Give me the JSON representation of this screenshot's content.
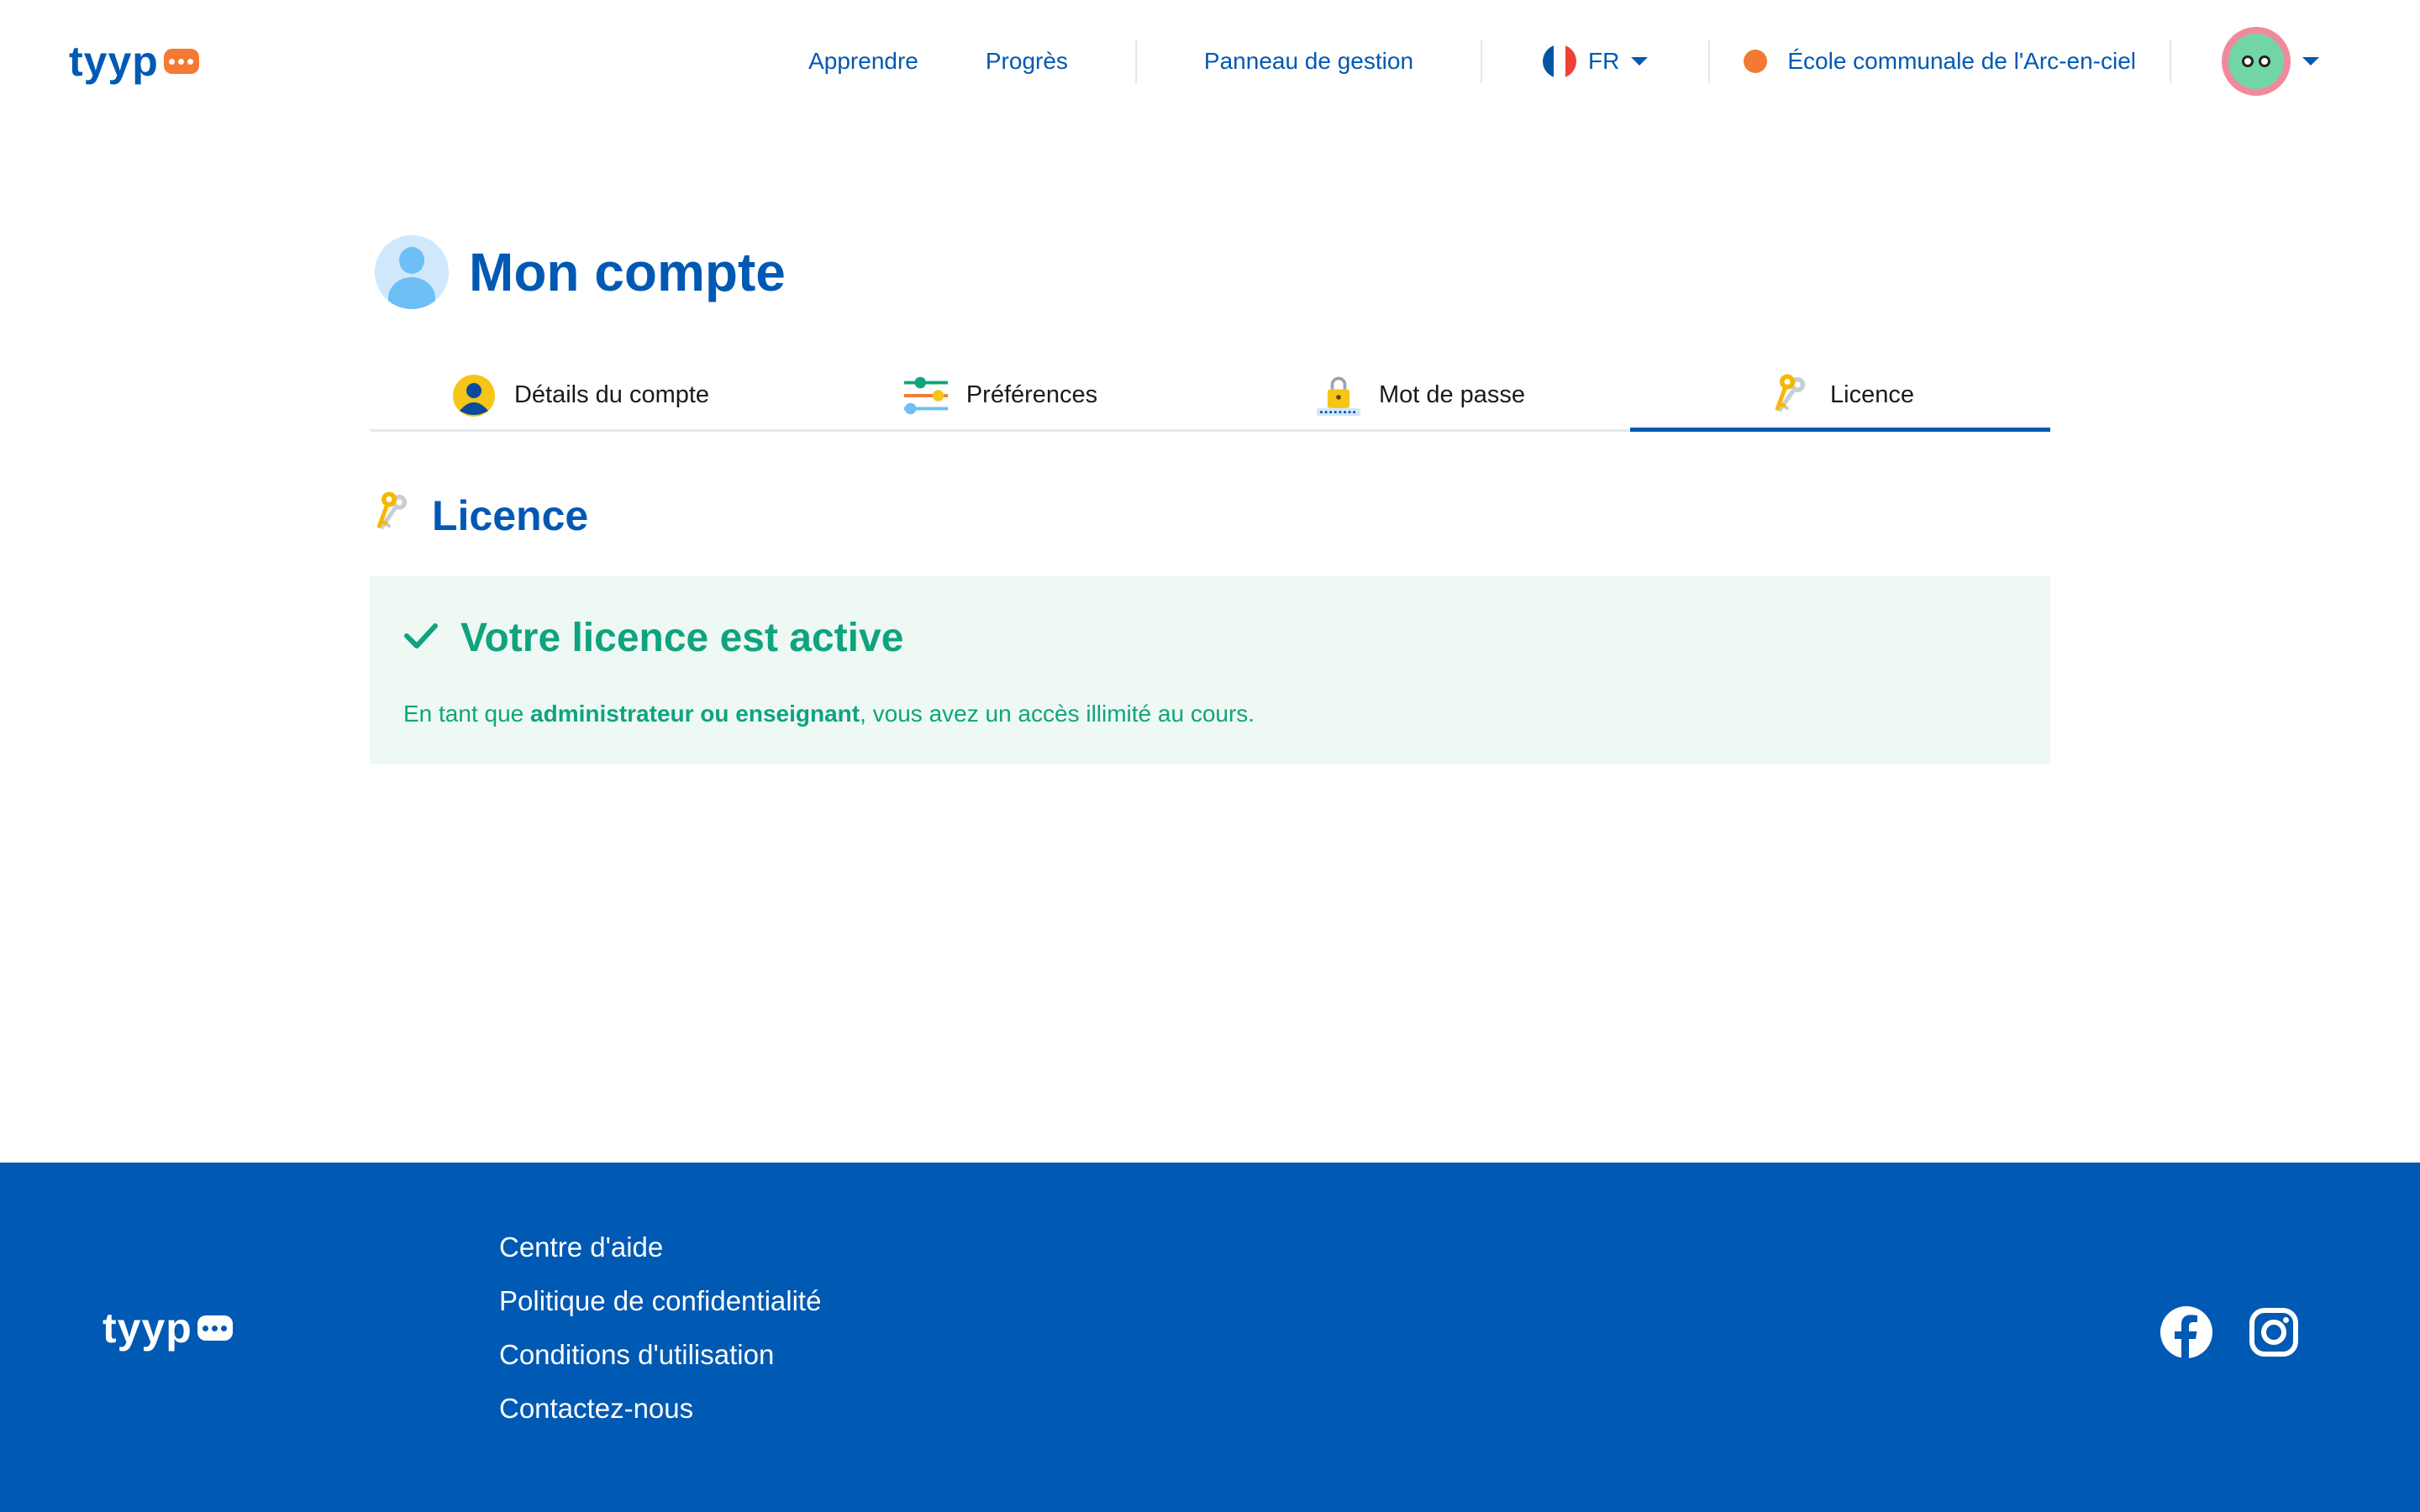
{
  "header": {
    "logo_text": "tyyp",
    "nav": {
      "learn": "Apprendre",
      "progress": "Progrès",
      "admin_panel": "Panneau de gestion"
    },
    "language": "FR",
    "school": "École communale de l'Arc-en-ciel"
  },
  "main": {
    "title": "Mon compte",
    "tabs": [
      {
        "label": "Détails du compte",
        "icon": "person-icon"
      },
      {
        "label": "Préférences",
        "icon": "sliders-icon"
      },
      {
        "label": "Mot de passe",
        "icon": "lock-icon"
      },
      {
        "label": "Licence",
        "icon": "keys-icon",
        "active": true
      }
    ],
    "section_title": "Licence",
    "license": {
      "status": "Votre licence est active",
      "desc_prefix": "En tant que ",
      "desc_bold": "administrateur ou enseignant",
      "desc_suffix": ", vous avez un accès illimité au cours."
    }
  },
  "footer": {
    "logo_text": "tyyp",
    "links": [
      "Centre d'aide",
      "Politique de confidentialité",
      "Conditions d'utilisation",
      "Contactez-nous"
    ],
    "social": [
      "facebook-icon",
      "instagram-icon"
    ]
  },
  "colors": {
    "brand_blue": "#0059b3",
    "accent_orange": "#f37a32",
    "success_green": "#10a37f",
    "success_bg": "#eef9f3"
  }
}
